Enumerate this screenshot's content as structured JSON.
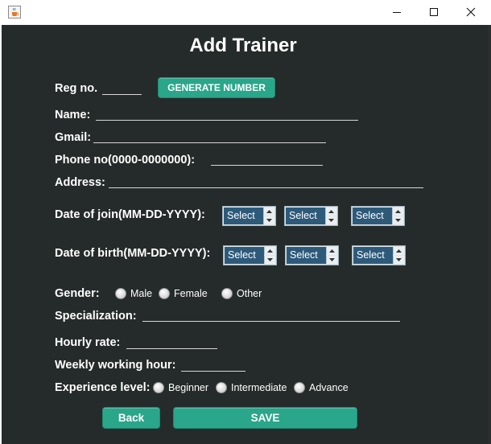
{
  "window": {
    "icon": "java-cup-icon",
    "controls": [
      "minimize-icon",
      "maximize-icon",
      "close-icon"
    ]
  },
  "form": {
    "title": "Add Trainer",
    "reg_label": "Reg no.",
    "generate_label": "GENERATE NUMBER",
    "name_label": "Name:",
    "gmail_label": "Gmail:",
    "phone_label": "Phone no(0000-0000000):",
    "address_label": "Address:",
    "join_label": "Date of join(MM-DD-YYYY):",
    "birth_label": "Date of birth(MM-DD-YYYY):",
    "join_selects": [
      "Select",
      "Select",
      "Select"
    ],
    "birth_selects": [
      "Select",
      "Select",
      "Select"
    ],
    "gender_label": "Gender:",
    "gender_options": [
      "Male",
      "Female",
      "Other"
    ],
    "specialization_label": "Specialization:",
    "hourly_label": "Hourly rate:",
    "weekly_label": "Weekly working hour:",
    "experience_label": "Experience level:",
    "experience_options": [
      "Beginner",
      "Intermediate",
      "Advance"
    ],
    "back_label": "Back",
    "save_label": "SAVE"
  },
  "colors": {
    "background": "#252b2a",
    "accent": "#2aa68a",
    "spinner_value": "#2e5a7a",
    "text": "#ffffff"
  }
}
